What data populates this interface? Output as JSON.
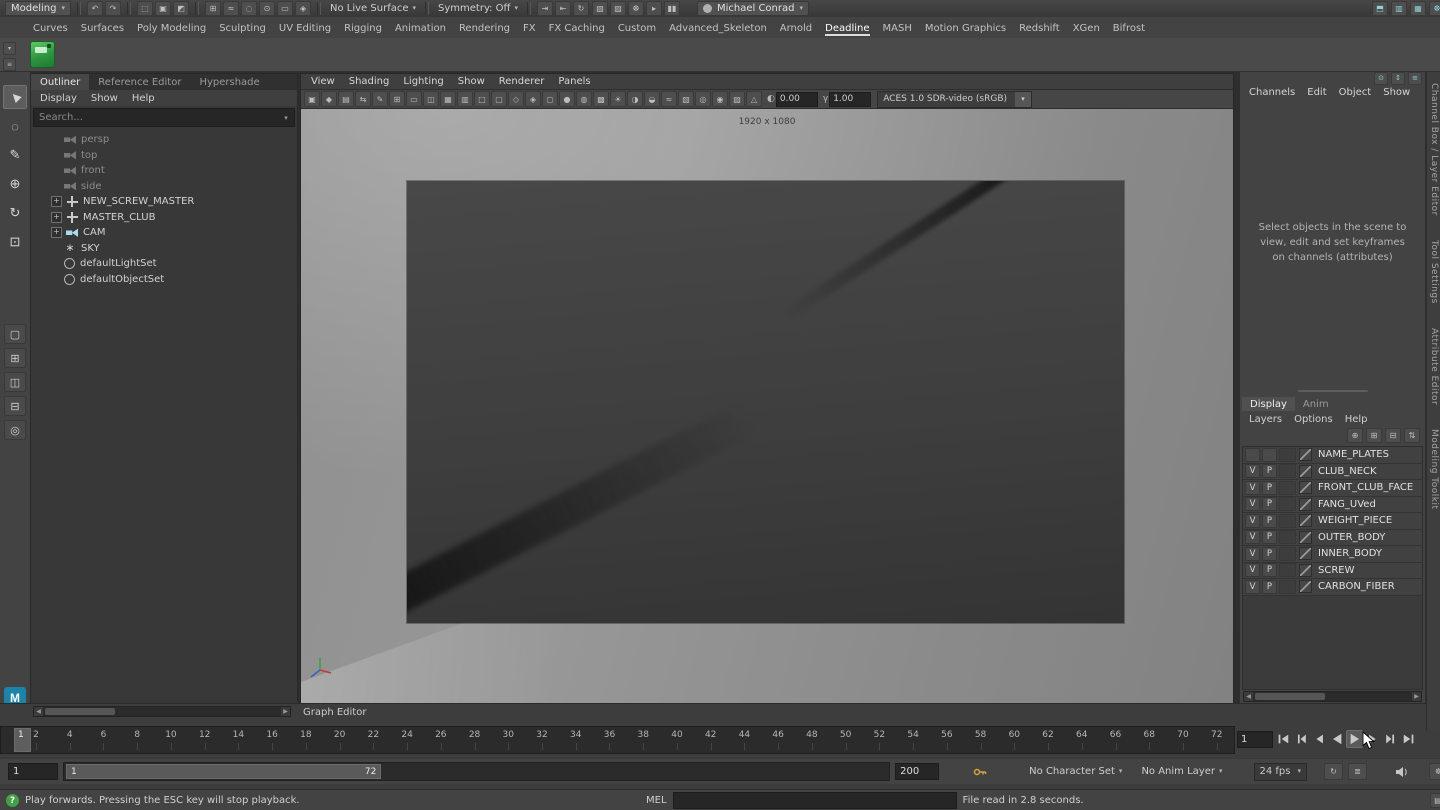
{
  "colors": {
    "background": "#3d3d3d",
    "panel": "#434343",
    "dark_field": "#262626",
    "accent_selection": "#5285a6",
    "shelf_green": "#2e9440",
    "maya_logo_blue": "#1b84a8",
    "help_green": "#44a047",
    "viewport_gray": "#8f8f8f"
  },
  "topbar": {
    "mode": "Modeling",
    "no_live_surface": "No Live Surface",
    "symmetry": "Symmetry: Off",
    "user": "Michael Conrad",
    "left_icons": [
      {
        "name": "undo-icon",
        "glyph": "↶"
      },
      {
        "name": "redo-icon",
        "glyph": "↷"
      }
    ],
    "select_icons": [
      {
        "name": "select-by-hierarchy-icon",
        "glyph": "⬚"
      },
      {
        "name": "select-by-object-icon",
        "glyph": "▣"
      },
      {
        "name": "select-by-component-icon",
        "glyph": "◩"
      }
    ],
    "snap_icons": [
      {
        "name": "snap-to-grid-icon",
        "glyph": "⊞"
      },
      {
        "name": "snap-to-curve-icon",
        "glyph": "≈"
      },
      {
        "name": "snap-to-point-icon",
        "glyph": "◌"
      },
      {
        "name": "snap-to-projected-center-icon",
        "glyph": "⊙"
      },
      {
        "name": "snap-to-view-plane-icon",
        "glyph": "▭"
      },
      {
        "name": "make-object-live-icon",
        "glyph": "◈"
      }
    ],
    "history_icons": [
      {
        "name": "input-connections-icon",
        "glyph": "⇥"
      },
      {
        "name": "output-connections-icon",
        "glyph": "⇤"
      },
      {
        "name": "construction-history-icon",
        "glyph": "↻"
      }
    ],
    "render_icons": [
      {
        "name": "render-frame-icon",
        "glyph": "▧"
      },
      {
        "name": "ipr-render-icon",
        "glyph": "▨"
      },
      {
        "name": "render-settings-icon",
        "glyph": "☸"
      },
      {
        "name": "playblast-icon",
        "glyph": "▸"
      },
      {
        "name": "pause-icon",
        "glyph": "▮▮"
      }
    ],
    "right_icons": [
      {
        "name": "workspace-icon",
        "glyph": "⬒"
      },
      {
        "name": "outliner-toggle-icon",
        "glyph": "▥"
      },
      {
        "name": "panel-layout-icon",
        "glyph": "▦"
      },
      {
        "name": "preferences-icon",
        "glyph": "☸"
      }
    ]
  },
  "menu_tabs": {
    "active": "Deadline",
    "items": [
      "Curves",
      "Surfaces",
      "Poly Modeling",
      "Sculpting",
      "UV Editing",
      "Rigging",
      "Animation",
      "Rendering",
      "FX",
      "FX Caching",
      "Custom",
      "Advanced_Skeleton",
      "Arnold",
      "Deadline",
      "MASH",
      "Motion Graphics",
      "Redshift",
      "XGen",
      "Bifrost"
    ]
  },
  "shelf": {
    "side_icons": [
      {
        "name": "shelf-tab-selector-icon",
        "glyph": "▾"
      },
      {
        "name": "shelf-menu-icon",
        "glyph": "≡"
      }
    ]
  },
  "toolbox": {
    "tools": [
      {
        "name": "select-tool",
        "glyph": "▶",
        "active": true
      },
      {
        "name": "lasso-tool",
        "glyph": "◌"
      },
      {
        "name": "paint-select-tool",
        "glyph": "✎"
      },
      {
        "name": "move-tool",
        "glyph": "⊕"
      },
      {
        "name": "rotate-tool",
        "glyph": "↻"
      },
      {
        "name": "scale-tool",
        "glyph": "⊡"
      }
    ],
    "layouts": [
      {
        "name": "single-pane-layout-button",
        "glyph": "▢"
      },
      {
        "name": "four-pane-layout-button",
        "glyph": "⊞"
      },
      {
        "name": "persp-outliner-layout-button",
        "glyph": "◫"
      },
      {
        "name": "stacked-pane-layout-button",
        "glyph": "⊟"
      },
      {
        "name": "zoom-tool-button",
        "glyph": "◎"
      }
    ],
    "logo_glyph": "M"
  },
  "outliner": {
    "tabs": [
      "Outliner",
      "Reference Editor",
      "Hypershade"
    ],
    "active_tab": "Outliner",
    "menus": [
      "Display",
      "Show",
      "Help"
    ],
    "search_placeholder": "Search...",
    "items": [
      {
        "label": "persp",
        "icon": "camera-icon",
        "expander": "",
        "muted": true
      },
      {
        "label": "top",
        "icon": "camera-icon",
        "expander": "",
        "muted": true
      },
      {
        "label": "front",
        "icon": "camera-icon",
        "expander": "",
        "muted": true
      },
      {
        "label": "side",
        "icon": "camera-icon",
        "expander": "",
        "muted": true
      },
      {
        "label": "NEW_SCREW_MASTER",
        "icon": "transform-icon",
        "expander": "+",
        "muted": false
      },
      {
        "label": "MASTER_CLUB",
        "icon": "transform-icon",
        "expander": "+",
        "muted": false
      },
      {
        "label": "CAM",
        "icon": "camera-blue-icon",
        "expander": "+",
        "muted": false
      },
      {
        "label": "SKY",
        "icon": "star-icon",
        "expander": "",
        "muted": false
      },
      {
        "label": "defaultLightSet",
        "icon": "set-icon",
        "expander": "",
        "muted": false
      },
      {
        "label": "defaultObjectSet",
        "icon": "set-icon",
        "expander": "",
        "muted": false
      }
    ]
  },
  "viewport": {
    "menus": [
      "View",
      "Shading",
      "Lighting",
      "Show",
      "Renderer",
      "Panels"
    ],
    "toolbar_icons": [
      {
        "name": "camera-attributes-icon",
        "glyph": "▣"
      },
      {
        "name": "bookmarks-icon",
        "glyph": "◆"
      },
      {
        "name": "image-plane-icon",
        "glyph": "▤"
      },
      {
        "name": "2d-pan-zoom-icon",
        "glyph": "⇆"
      },
      {
        "name": "grease-pencil-icon",
        "glyph": "✎"
      },
      {
        "name": "grid-icon",
        "glyph": "⊞"
      },
      {
        "name": "film-gate-icon",
        "glyph": "▭"
      },
      {
        "name": "resolution-gate-icon",
        "glyph": "◫"
      },
      {
        "name": "gate-mask-icon",
        "glyph": "▦"
      },
      {
        "name": "field-chart-icon",
        "glyph": "▥"
      },
      {
        "name": "safe-action-icon",
        "glyph": "□"
      },
      {
        "name": "safe-title-icon",
        "glyph": "▢"
      },
      {
        "name": "frame-all-icon",
        "glyph": "◇"
      },
      {
        "name": "frame-selection-icon",
        "glyph": "◈"
      },
      {
        "name": "wireframe-icon",
        "glyph": "◻"
      },
      {
        "name": "smooth-shade-icon",
        "glyph": "●"
      },
      {
        "name": "wireframe-on-shaded-icon",
        "glyph": "◍"
      },
      {
        "name": "textured-icon",
        "glyph": "▩"
      },
      {
        "name": "use-all-lights-icon",
        "glyph": "☀"
      },
      {
        "name": "shadows-icon",
        "glyph": "◑"
      },
      {
        "name": "screen-space-ao-icon",
        "glyph": "◒"
      },
      {
        "name": "motion-blur-icon",
        "glyph": "≈"
      },
      {
        "name": "multisample-aa-icon",
        "glyph": "▧"
      },
      {
        "name": "depth-of-field-icon",
        "glyph": "◎"
      },
      {
        "name": "isolate-select-icon",
        "glyph": "◉"
      },
      {
        "name": "xray-icon",
        "glyph": "▨"
      },
      {
        "name": "xray-joints-icon",
        "glyph": "△"
      }
    ],
    "exposure_icon_glyph": "◐",
    "exposure_value": "0.00",
    "gamma_icon_glyph": "γ",
    "gamma_value": "1.00",
    "colorspace": "ACES 1.0 SDR-video (sRGB)",
    "resolution": "1920 x 1080"
  },
  "channel_box": {
    "header_icons": [
      {
        "name": "pin-channel-box-icon",
        "glyph": "⊙"
      },
      {
        "name": "channel-sliders-icon",
        "glyph": "↕"
      },
      {
        "name": "channel-options-icon",
        "glyph": "≡"
      }
    ],
    "menus": [
      "Channels",
      "Edit",
      "Object",
      "Show"
    ],
    "placeholder": "Select objects in the scene to view, edit and set keyframes on channels (attributes)"
  },
  "layer_editor": {
    "tabs": [
      "Display",
      "Anim"
    ],
    "active_tab": "Display",
    "menus": [
      "Layers",
      "Options",
      "Help"
    ],
    "toolbar_icons": [
      {
        "name": "new-empty-layer-icon",
        "glyph": "⊕"
      },
      {
        "name": "new-layer-from-selected-icon",
        "glyph": "⊞"
      },
      {
        "name": "delete-layer-icon",
        "glyph": "⊟"
      },
      {
        "name": "sort-layers-icon",
        "glyph": "⇅"
      }
    ],
    "layers": [
      {
        "v": "",
        "p": "",
        "name": "NAME_PLATES"
      },
      {
        "v": "V",
        "p": "P",
        "name": "CLUB_NECK"
      },
      {
        "v": "V",
        "p": "P",
        "name": "FRONT_CLUB_FACE"
      },
      {
        "v": "V",
        "p": "P",
        "name": "FANG_UVed"
      },
      {
        "v": "V",
        "p": "P",
        "name": "WEIGHT_PIECE"
      },
      {
        "v": "V",
        "p": "P",
        "name": "OUTER_BODY"
      },
      {
        "v": "V",
        "p": "P",
        "name": "INNER_BODY"
      },
      {
        "v": "V",
        "p": "P",
        "name": "SCREW"
      },
      {
        "v": "V",
        "p": "P",
        "name": "CARBON_FIBER"
      }
    ]
  },
  "right_rail": {
    "tabs": [
      "Channel Box / Layer Editor",
      "Tool Settings",
      "Attribute Editor",
      "Modeling Toolkit"
    ]
  },
  "graph_editor": {
    "label": "Graph Editor"
  },
  "timeline": {
    "ticks": [
      "2",
      "4",
      "6",
      "8",
      "10",
      "12",
      "14",
      "16",
      "18",
      "20",
      "22",
      "24",
      "26",
      "28",
      "30",
      "32",
      "34",
      "36",
      "38",
      "40",
      "42",
      "44",
      "46",
      "48",
      "50",
      "52",
      "54",
      "56",
      "58",
      "60",
      "62",
      "64",
      "66",
      "68",
      "70",
      "72"
    ],
    "current_frame": "1",
    "frame_field": "1",
    "playback_buttons": [
      "go-to-start-button",
      "step-back-frame-button",
      "step-back-key-button",
      "play-backwards-button",
      "play-forwards-button",
      "step-forward-key-button",
      "step-forward-frame-button",
      "go-to-end-button"
    ]
  },
  "range_slider": {
    "start": "1",
    "range_start": "1",
    "range_end": "72",
    "end": "200",
    "character_set": "No Character Set",
    "anim_layer": "No Anim Layer",
    "fps": "24 fps"
  },
  "status_bar": {
    "help_glyph": "?",
    "help": "Play forwards. Pressing the ESC key will stop playback.",
    "command_label": "MEL",
    "message": "File read in  2.8 seconds."
  }
}
